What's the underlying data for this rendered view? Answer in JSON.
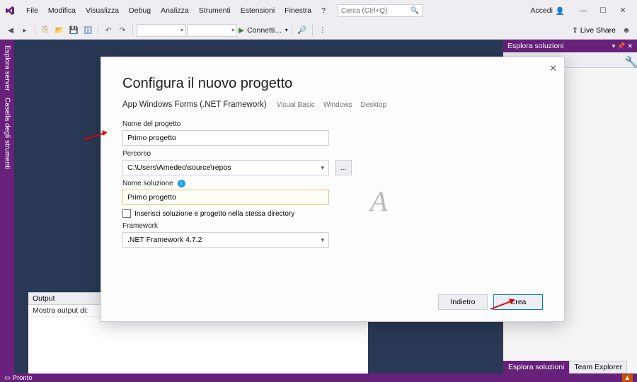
{
  "menubar": [
    "File",
    "Modifica",
    "Visualizza",
    "Debug",
    "Analizza",
    "Strumenti",
    "Estensioni",
    "Finestra",
    "?"
  ],
  "search_placeholder": "Cerca (Ctrl+Q)",
  "signin_label": "Accedi",
  "toolbar": {
    "connect_label": "Connetti…",
    "live_share": "Live Share"
  },
  "left_tabs": [
    "Esplora server",
    "Casella degli strumenti"
  ],
  "solution_explorer": {
    "title": "Esplora soluzioni",
    "tab_solution": "Esplora soluzioni",
    "tab_team": "Team Explorer"
  },
  "output": {
    "title": "Output",
    "show_output": "Mostra output di:"
  },
  "dialog": {
    "title": "Configura il nuovo progetto",
    "template": "App Windows Forms (.NET Framework)",
    "tags": [
      "Visual Basic",
      "Windows",
      "Desktop"
    ],
    "label_project": "Nome del progetto",
    "project_name": "Primo progetto",
    "label_path": "Percorso",
    "path": "C:\\Users\\Amedeo\\source\\repos",
    "browse": "...",
    "label_solution": "Nome soluzione",
    "solution_name": "Primo progetto",
    "checkbox": "Inserisci soluzione e progetto nella stessa directory",
    "label_framework": "Framework",
    "framework": ".NET Framework 4.7.2",
    "btn_back": "Indietro",
    "btn_create": "Crea"
  },
  "status": {
    "ready": "Pronto"
  },
  "watermark": "A"
}
